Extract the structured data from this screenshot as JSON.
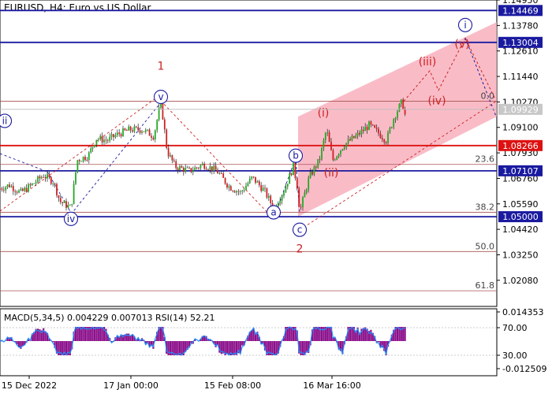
{
  "title": "EURUSD, H4:  Euro vs US Dollar",
  "indicator_label": "MACD(5,34,5) 0.004229 0.007013 RSI(14) 52.21",
  "colors": {
    "bull": "#22aa22",
    "bear": "#cc2222",
    "blue_line": "#1a1aa0",
    "red_line": "#dd1111",
    "fib_line": "#a85050",
    "channel_fill": "#f7a6b4",
    "wave_red": "#cc2222",
    "wave_blue": "#1a1aa0",
    "macd_hist": "#8b0f8b",
    "rsi_line": "#1e90ff"
  },
  "chart_data": {
    "type": "candlestick",
    "symbol": "EURUSD",
    "timeframe": "H4",
    "ylim": [
      1.0088,
      1.1495
    ],
    "x_ticks": [
      "15 Dec 2022",
      "17 Jan 00:00",
      "15 Feb 08:00",
      "16 Mar 16:00"
    ],
    "y_ticks": [
      "1.14950",
      "1.13780",
      "1.12610",
      "1.11440",
      "1.10270",
      "1.09100",
      "1.07930",
      "1.06760",
      "1.05590",
      "1.04420",
      "1.03250",
      "1.02080"
    ],
    "price_path": [
      {
        "t": 0,
        "p": 1.063
      },
      {
        "t": 12,
        "p": 1.0645
      },
      {
        "t": 26,
        "p": 1.061
      },
      {
        "t": 40,
        "p": 1.0645
      },
      {
        "t": 55,
        "p": 1.069
      },
      {
        "t": 68,
        "p": 1.066
      },
      {
        "t": 76,
        "p": 1.057
      },
      {
        "t": 90,
        "p": 1.054
      },
      {
        "t": 98,
        "p": 1.076
      },
      {
        "t": 112,
        "p": 1.078
      },
      {
        "t": 122,
        "p": 1.086
      },
      {
        "t": 136,
        "p": 1.085
      },
      {
        "t": 150,
        "p": 1.088
      },
      {
        "t": 165,
        "p": 1.09
      },
      {
        "t": 180,
        "p": 1.09
      },
      {
        "t": 195,
        "p": 1.087
      },
      {
        "t": 204,
        "p": 1.103
      },
      {
        "t": 212,
        "p": 1.08
      },
      {
        "t": 222,
        "p": 1.073
      },
      {
        "t": 240,
        "p": 1.071
      },
      {
        "t": 258,
        "p": 1.074
      },
      {
        "t": 275,
        "p": 1.071
      },
      {
        "t": 290,
        "p": 1.064
      },
      {
        "t": 305,
        "p": 1.061
      },
      {
        "t": 320,
        "p": 1.068
      },
      {
        "t": 335,
        "p": 1.062
      },
      {
        "t": 347,
        "p": 1.054
      },
      {
        "t": 360,
        "p": 1.062
      },
      {
        "t": 372,
        "p": 1.073
      },
      {
        "t": 378,
        "p": 1.062
      },
      {
        "t": 380,
        "p": 1.052
      },
      {
        "t": 392,
        "p": 1.068
      },
      {
        "t": 405,
        "p": 1.076
      },
      {
        "t": 414,
        "p": 1.09
      },
      {
        "t": 422,
        "p": 1.076
      },
      {
        "t": 436,
        "p": 1.083
      },
      {
        "t": 452,
        "p": 1.087
      },
      {
        "t": 468,
        "p": 1.092
      },
      {
        "t": 478,
        "p": 1.089
      },
      {
        "t": 490,
        "p": 1.085
      },
      {
        "t": 500,
        "p": 1.096
      },
      {
        "t": 510,
        "p": 1.103
      },
      {
        "t": 514,
        "p": 1.096
      }
    ],
    "horizontal_levels": [
      {
        "label": "1.14469",
        "value": 1.14469,
        "kind": "blue"
      },
      {
        "label": "1.13004",
        "value": 1.13004,
        "kind": "blue"
      },
      {
        "label": "1.08266",
        "value": 1.08266,
        "kind": "red"
      },
      {
        "label": "1.07107",
        "value": 1.07107,
        "kind": "blue"
      },
      {
        "label": "1.05000",
        "value": 1.05,
        "kind": "blue"
      }
    ],
    "current_price": {
      "label": "1.09929",
      "value": 1.09929
    },
    "fib_levels": [
      {
        "label": "0.0",
        "value": 1.103
      },
      {
        "label": "23.6",
        "value": 1.074
      },
      {
        "label": "38.2",
        "value": 1.052
      },
      {
        "label": "50.0",
        "value": 1.034
      },
      {
        "label": "61.8",
        "value": 1.016
      }
    ],
    "wave_labels": [
      {
        "text": "1",
        "t": 204,
        "p": 1.119,
        "style": "plain-red"
      },
      {
        "text": "2",
        "t": 380,
        "p": 1.035,
        "style": "plain-red"
      },
      {
        "text": "v",
        "t": 204,
        "p": 1.105,
        "style": "circle-blue"
      },
      {
        "text": "iv",
        "t": 90,
        "p": 1.049,
        "style": "circle-blue"
      },
      {
        "text": "ii",
        "t": 6,
        "p": 1.094,
        "style": "circle-blue"
      },
      {
        "text": "a",
        "t": 347,
        "p": 1.052,
        "style": "circle-blue"
      },
      {
        "text": "b",
        "t": 375,
        "p": 1.078,
        "style": "circle-blue"
      },
      {
        "text": "c",
        "t": 380,
        "p": 1.044,
        "style": "circle-blue"
      },
      {
        "text": "i",
        "t": 590,
        "p": 1.138,
        "style": "circle-blue"
      },
      {
        "text": "(i)",
        "t": 410,
        "p": 1.0975,
        "style": "plain-red"
      },
      {
        "text": "(ii)",
        "t": 420,
        "p": 1.07,
        "style": "plain-red"
      },
      {
        "text": "(iii)",
        "t": 542,
        "p": 1.121,
        "style": "plain-red"
      },
      {
        "text": "(iv)",
        "t": 554,
        "p": 1.103,
        "style": "plain-red"
      },
      {
        "text": "(v)",
        "t": 586,
        "p": 1.129,
        "style": "plain-red"
      }
    ],
    "projection_path": [
      {
        "t": 512,
        "p": 1.103
      },
      {
        "t": 545,
        "p": 1.117
      },
      {
        "t": 556,
        "p": 1.108
      },
      {
        "t": 590,
        "p": 1.132
      },
      {
        "t": 628,
        "p": 1.104
      }
    ],
    "subwindow": {
      "y_ticks": [
        "0.014353",
        "70.00",
        "30.00",
        "-0.012509"
      ]
    }
  }
}
